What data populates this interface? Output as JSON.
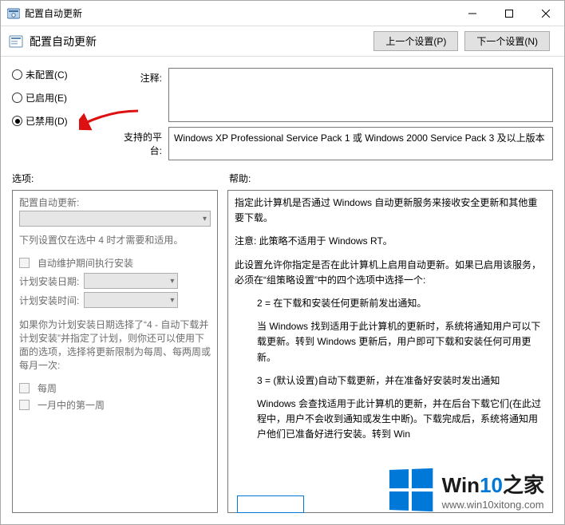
{
  "titlebar": {
    "title": "配置自动更新"
  },
  "header": {
    "title": "配置自动更新",
    "prev": "上一个设置(P)",
    "next": "下一个设置(N)"
  },
  "radios": {
    "not_configured": "未配置(C)",
    "enabled": "已启用(E)",
    "disabled": "已禁用(D)"
  },
  "labels": {
    "comment": "注释:",
    "platform": "支持的平台:",
    "options": "选项:",
    "help": "帮助:"
  },
  "platform_text": "Windows XP Professional Service Pack 1 或 Windows 2000 Service Pack 3 及以上版本",
  "options": {
    "title": "配置自动更新:",
    "note": "下列设置仅在选中 4 时才需要和适用。",
    "chk_maintenance": "自动维护期间执行安装",
    "date_label": "计划安装日期:",
    "time_label": "计划安装时间:",
    "para": "如果你为计划安装日期选择了“4 - 自动下载并计划安装”并指定了计划，则你还可以使用下面的选项，选择将更新限制为每周、每两周或每月一次:",
    "chk_weekly": "每周",
    "chk_first_week": "一月中的第一周"
  },
  "help": {
    "p1": "指定此计算机是否通过 Windows 自动更新服务来接收安全更新和其他重要下载。",
    "p2": "注意: 此策略不适用于 Windows RT。",
    "p3": "此设置允许你指定是否在此计算机上启用自动更新。如果已启用该服务，必须在“组策略设置”中的四个选项中选择一个:",
    "p4": "2 = 在下载和安装任何更新前发出通知。",
    "p5": "当 Windows 找到适用于此计算机的更新时，系统将通知用户可以下载更新。转到 Windows 更新后，用户即可下载和安装任何可用更新。",
    "p6": "3 = (默认设置)自动下载更新，并在准备好安装时发出通知",
    "p7": "Windows 会查找适用于此计算机的更新，并在后台下载它们(在此过程中，用户不会收到通知或发生中断)。下载完成后，系统将通知用户他们已准备好进行安装。转到 Win"
  },
  "watermark": {
    "name": "Win10之家",
    "url": "www.win10xitong.com"
  }
}
